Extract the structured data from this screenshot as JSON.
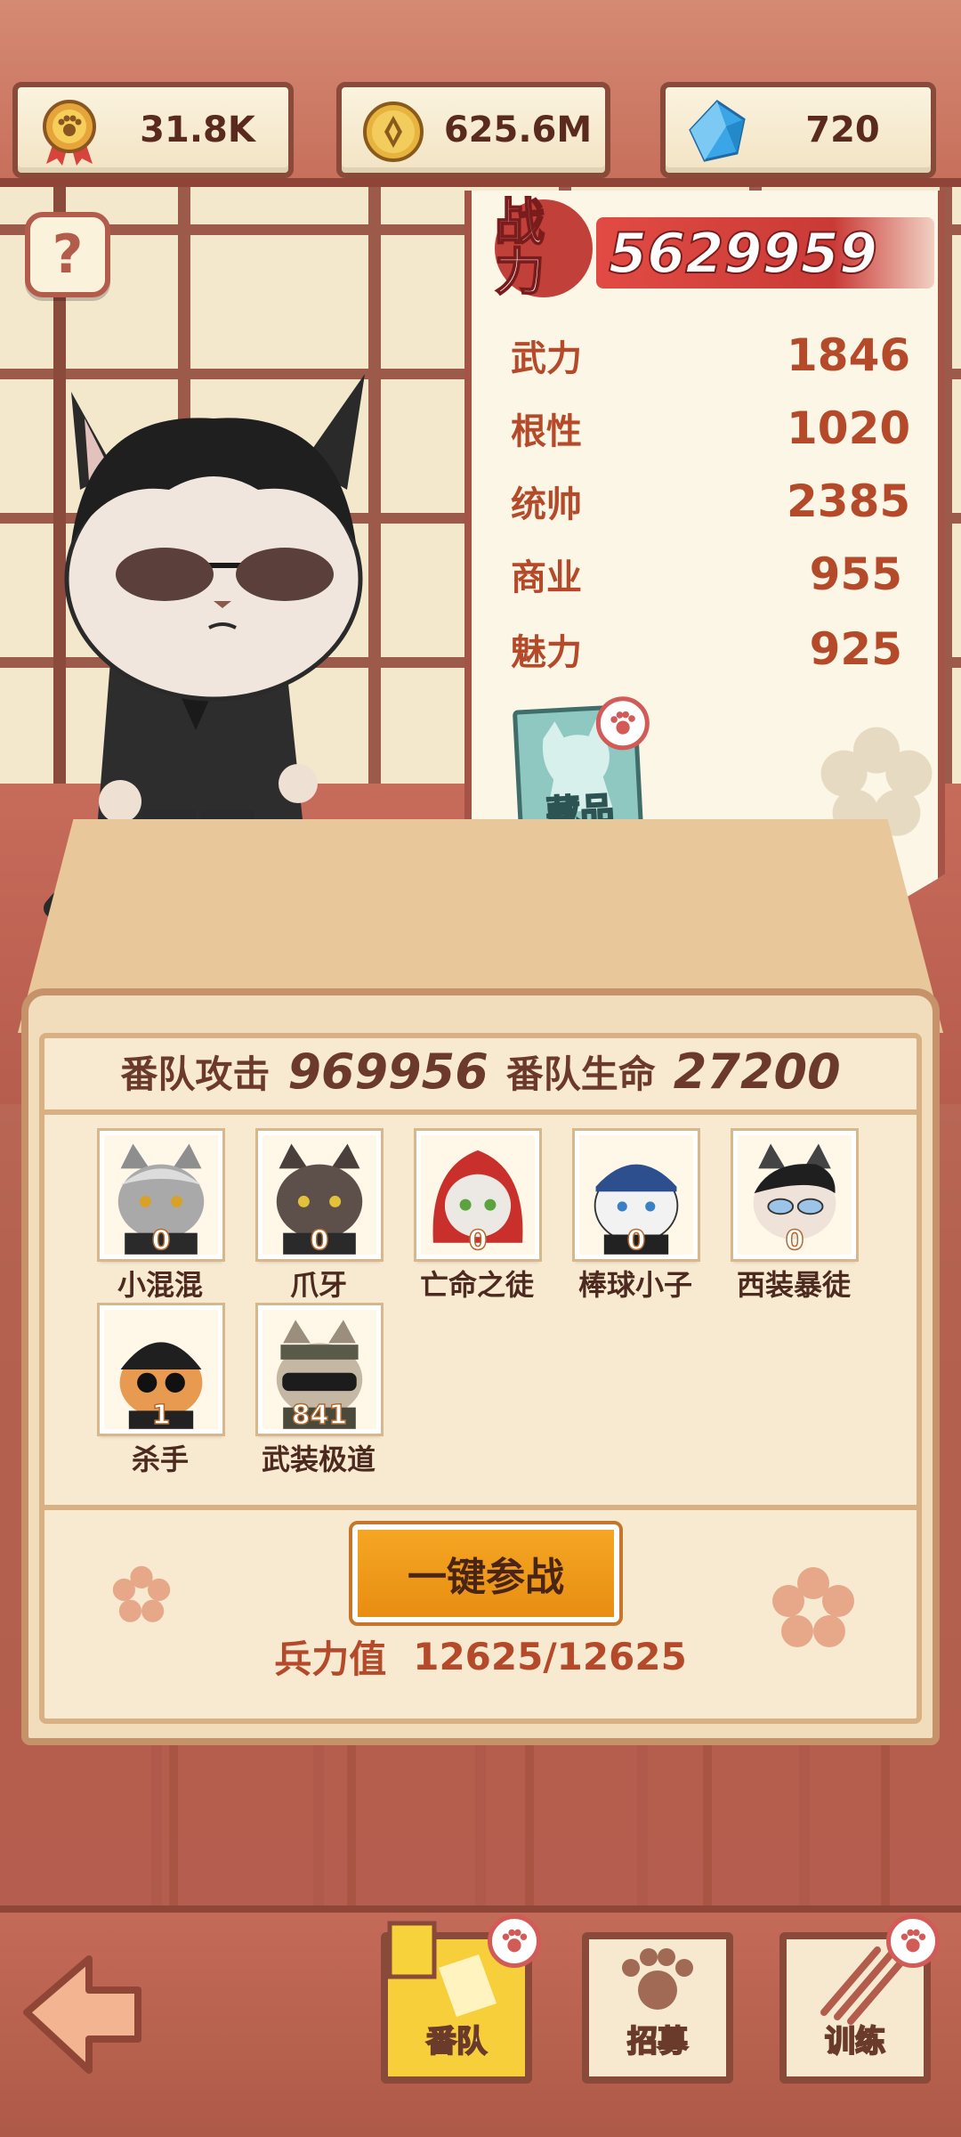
{
  "resources": [
    {
      "icon": "medal-icon",
      "value": "31.8K"
    },
    {
      "icon": "coin-icon",
      "value": "625.6M"
    },
    {
      "icon": "gem-icon",
      "value": "720"
    }
  ],
  "help_label": "?",
  "stats": {
    "power_label": "战力",
    "power_value": "5629959",
    "rows": [
      {
        "key": "武力",
        "value": "1846"
      },
      {
        "key": "根性",
        "value": "1020"
      },
      {
        "key": "统帅",
        "value": "2385"
      },
      {
        "key": "商业",
        "value": "955"
      },
      {
        "key": "魅力",
        "value": "925"
      }
    ],
    "collection_label": "藏品"
  },
  "team": {
    "attack_label": "番队攻击",
    "attack_value": "969956",
    "hp_label": "番队生命",
    "hp_value": "27200",
    "members": [
      {
        "name": "小混混",
        "level": "0"
      },
      {
        "name": "爪牙",
        "level": "0"
      },
      {
        "name": "亡命之徒",
        "level": "0"
      },
      {
        "name": "棒球小子",
        "level": "0"
      },
      {
        "name": "西装暴徒",
        "level": "0"
      },
      {
        "name": "杀手",
        "level": "1"
      },
      {
        "name": "武装极道",
        "level": "841"
      }
    ],
    "join_button": "一键参战",
    "troop_label": "兵力值",
    "troop_value": "12625/12625"
  },
  "nav": {
    "tabs": [
      {
        "label": "番队",
        "active": true
      },
      {
        "label": "招募",
        "active": false
      },
      {
        "label": "训练",
        "active": false
      }
    ]
  },
  "colors": {
    "accent_red": "#c93a36",
    "stat_text": "#b54a2a",
    "button_orange": "#f5a623"
  }
}
